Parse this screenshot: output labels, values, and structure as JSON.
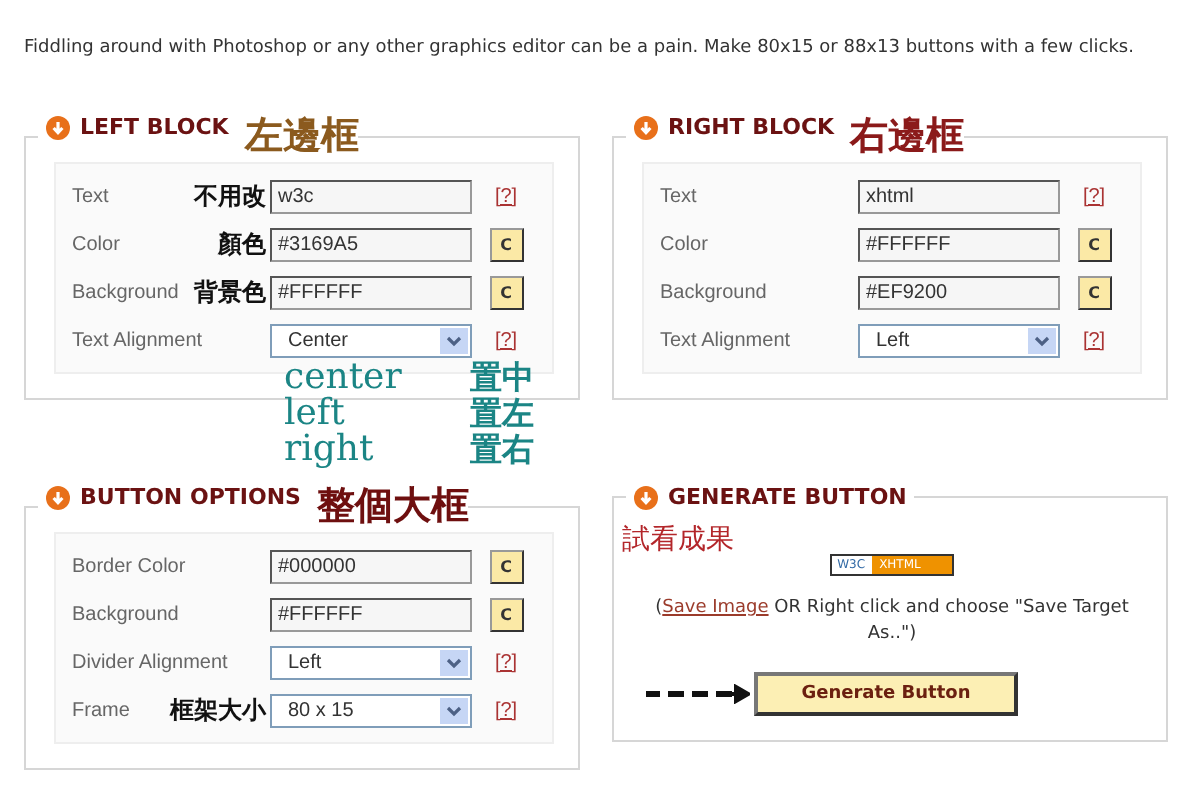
{
  "intro": "Fiddling around with Photoshop or any other graphics editor can be a pain. Make 80x15 or 88x13 buttons with a few clicks.",
  "panels": [
    {
      "kind": "form",
      "title": "LEFT BLOCK",
      "note": "左邊框",
      "rows": [
        {
          "label": "Text",
          "note": "不用改",
          "kind": "text",
          "value": "w3c",
          "action": {
            "kind": "help",
            "label": "[?]"
          }
        },
        {
          "label": "Color",
          "note": "顏色",
          "kind": "text",
          "value": "#3169A5",
          "action": {
            "kind": "color",
            "label": "C"
          }
        },
        {
          "label": "Background",
          "note": "背景色",
          "kind": "text",
          "value": "#FFFFFF",
          "action": {
            "kind": "color",
            "label": "C"
          }
        },
        {
          "label": "Text Alignment",
          "kind": "select",
          "value": "Center",
          "action": {
            "kind": "help",
            "label": "[?]"
          }
        }
      ],
      "notes": [
        {
          "en": "center",
          "zh": "置中"
        },
        {
          "en": "left",
          "zh": "置左"
        },
        {
          "en": "right",
          "zh": "置右"
        }
      ]
    },
    {
      "kind": "form",
      "title": "RIGHT BLOCK",
      "note": "右邊框",
      "rows": [
        {
          "label": "Text",
          "kind": "text",
          "value": "xhtml",
          "action": {
            "kind": "help",
            "label": "[?]"
          }
        },
        {
          "label": "Color",
          "kind": "text",
          "value": "#FFFFFF",
          "action": {
            "kind": "color",
            "label": "C"
          }
        },
        {
          "label": "Background",
          "kind": "text",
          "value": "#EF9200",
          "action": {
            "kind": "color",
            "label": "C"
          }
        },
        {
          "label": "Text Alignment",
          "kind": "select",
          "value": "Left",
          "action": {
            "kind": "help",
            "label": "[?]"
          }
        }
      ]
    },
    {
      "kind": "form",
      "title": "BUTTON OPTIONS",
      "note": "整個大框",
      "rows": [
        {
          "label": "Border Color",
          "kind": "text",
          "value": "#000000",
          "action": {
            "kind": "color",
            "label": "C"
          }
        },
        {
          "label": "Background",
          "kind": "text",
          "value": "#FFFFFF",
          "action": {
            "kind": "color",
            "label": "C"
          }
        },
        {
          "label": "Divider Alignment",
          "kind": "select",
          "value": "Left",
          "action": {
            "kind": "help",
            "label": "[?]"
          }
        },
        {
          "label": "Frame",
          "note": "框架大小",
          "kind": "select",
          "value": "80 x 15",
          "action": {
            "kind": "help",
            "label": "[?]"
          }
        }
      ]
    },
    {
      "kind": "generate",
      "title": "GENERATE BUTTON",
      "note": "試看成果",
      "preview": {
        "left": "W3C",
        "right": "XHTML"
      },
      "hint_before": "(",
      "hint_link": "Save Image",
      "hint_after": " OR Right click and choose \"Save Target As..\")",
      "button": "Generate Button"
    }
  ]
}
